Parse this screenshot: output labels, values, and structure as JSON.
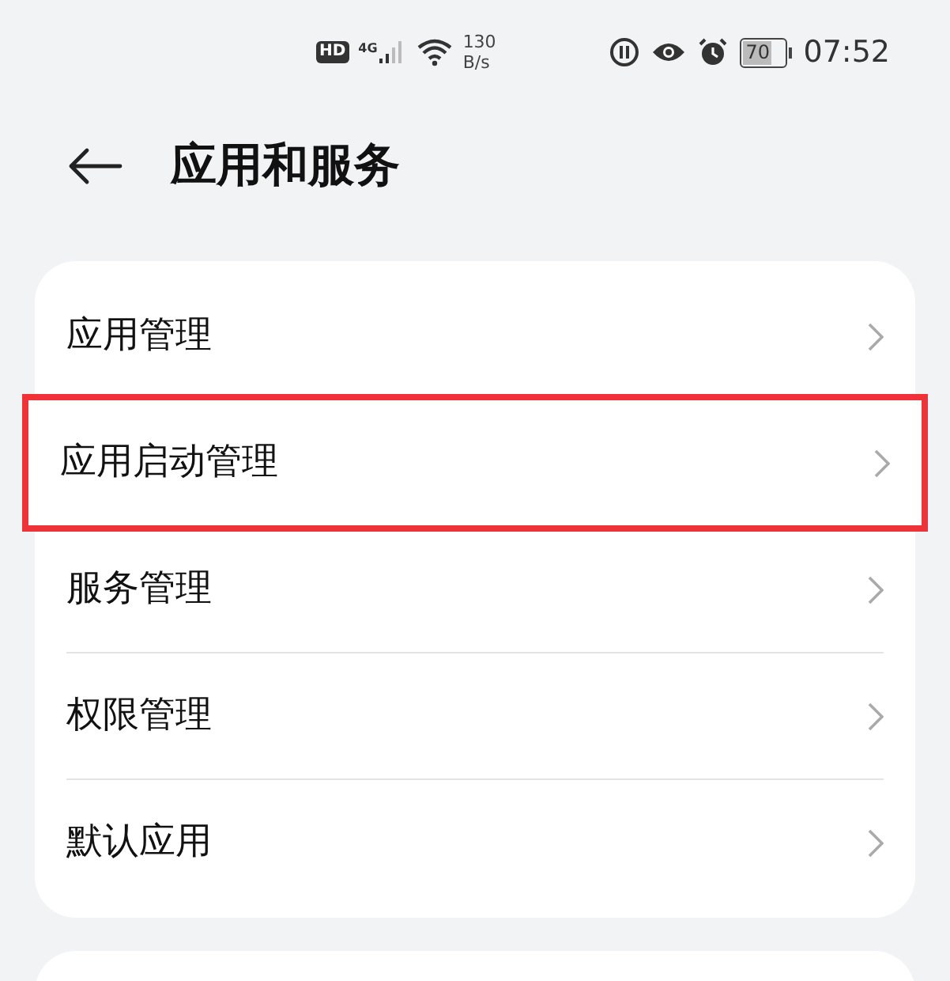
{
  "status_bar": {
    "hd": "HD",
    "network": "4G",
    "speed_value": "130",
    "speed_unit": "B/s",
    "battery": "70",
    "time": "07:52"
  },
  "header": {
    "title": "应用和服务"
  },
  "items": [
    {
      "label": "应用管理",
      "highlighted": false
    },
    {
      "label": "应用启动管理",
      "highlighted": true
    },
    {
      "label": "服务管理",
      "highlighted": false
    },
    {
      "label": "权限管理",
      "highlighted": false
    },
    {
      "label": "默认应用",
      "highlighted": false
    }
  ]
}
